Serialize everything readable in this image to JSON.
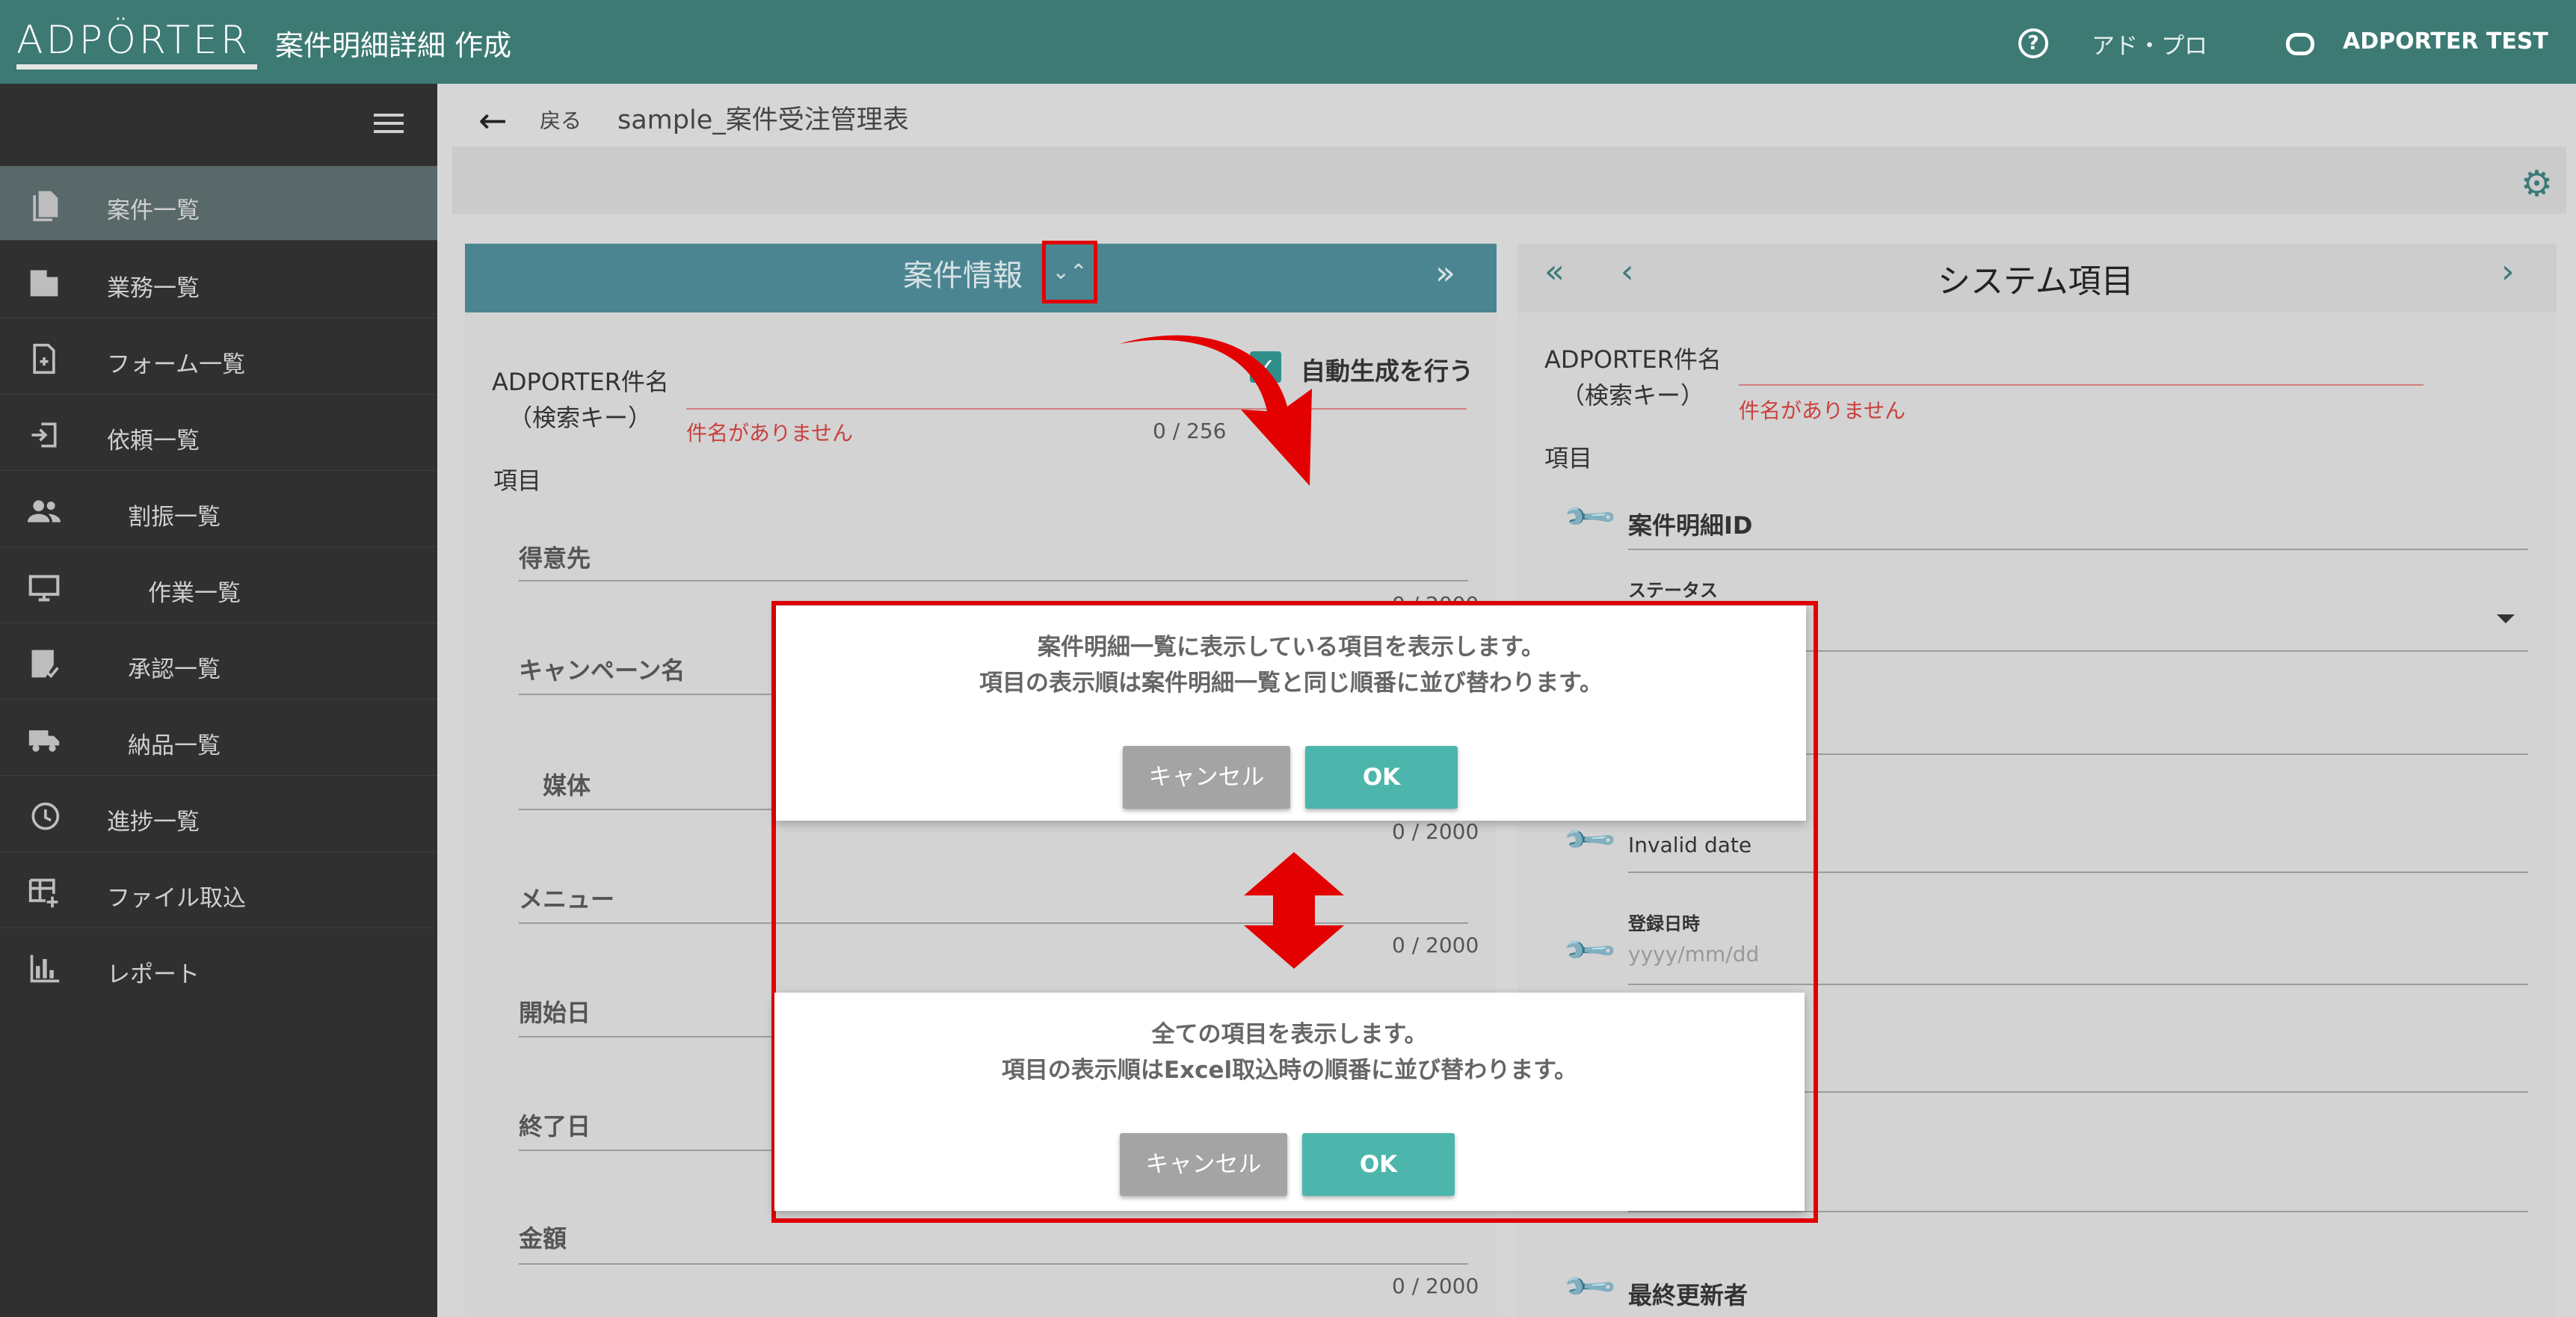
{
  "header": {
    "logo": "ADPÖRTER",
    "title": "案件明細詳細 作成",
    "help_label": "アド・プロ",
    "user_label": "ADPORTER TEST"
  },
  "sidebar": {
    "items": [
      {
        "label": "案件一覧",
        "icon": "document-icon"
      },
      {
        "label": "業務一覧",
        "icon": "building-icon"
      },
      {
        "label": "フォーム一覧",
        "icon": "form-file-icon"
      },
      {
        "label": "依頼一覧",
        "icon": "login-icon"
      },
      {
        "label": "割振一覧",
        "icon": "people-icon"
      },
      {
        "label": "作業一覧",
        "icon": "monitor-icon"
      },
      {
        "label": "承認一覧",
        "icon": "approval-icon"
      },
      {
        "label": "納品一覧",
        "icon": "truck-icon"
      },
      {
        "label": "進捗一覧",
        "icon": "history-icon"
      },
      {
        "label": "ファイル取込",
        "icon": "table-add-icon"
      },
      {
        "label": "レポート",
        "icon": "bar-chart-icon"
      }
    ]
  },
  "topbar": {
    "back_label": "戻る",
    "sheet_name": "sample_案件受注管理表"
  },
  "left_panel": {
    "title": "案件情報",
    "collapse_glyph": "⌄⌃",
    "next_glyph": "»",
    "auto_generate_label": "自動生成を行う",
    "name_label_1": "ADPORTER件名",
    "name_label_2": "（検索キー）",
    "name_error": "件名がありません",
    "name_counter": "0 / 256",
    "items_label": "項目",
    "fields": [
      {
        "label": "得意先",
        "counter": "0 / 2000"
      },
      {
        "label": "キャンペーン名",
        "counter": ""
      },
      {
        "label": "媒体",
        "counter": "0 / 2000"
      },
      {
        "label": "メニュー",
        "counter": "0 / 2000"
      },
      {
        "label": "開始日",
        "counter": ""
      },
      {
        "label": "終了日",
        "counter": ""
      },
      {
        "label": "金額",
        "counter": "0 / 2000"
      }
    ]
  },
  "right_panel": {
    "first_glyph": "«",
    "prev_glyph": "‹",
    "next_glyph": "›",
    "title": "システム項目",
    "name_label_1": "ADPORTER件名",
    "name_label_2": "（検索キー）",
    "name_error": "件名がありません",
    "items_label": "項目",
    "detail_id": "案件明細ID",
    "status_label": "ステータス",
    "invalid_date": "Invalid date",
    "registered_label": "登録日時",
    "registered_placeholder": "yyyy/mm/dd",
    "last_updater": "最終更新者"
  },
  "dialog_top": {
    "line1": "案件明細一覧に表示している項目を表示します。",
    "line2": "項目の表示順は案件明細一覧と同じ順番に並び替わります。",
    "cancel": "キャンセル",
    "ok": "OK"
  },
  "dialog_bottom": {
    "line1": "全ての項目を表示します。",
    "line2": "項目の表示順はExcel取込時の順番に並び替わります。",
    "cancel": "キャンセル",
    "ok": "OK"
  },
  "colors": {
    "header": "#3d7a74",
    "sidebar": "#303030",
    "panel_head": "#4b8592",
    "accent": "#4db6ac",
    "annotation": "#e30000"
  }
}
